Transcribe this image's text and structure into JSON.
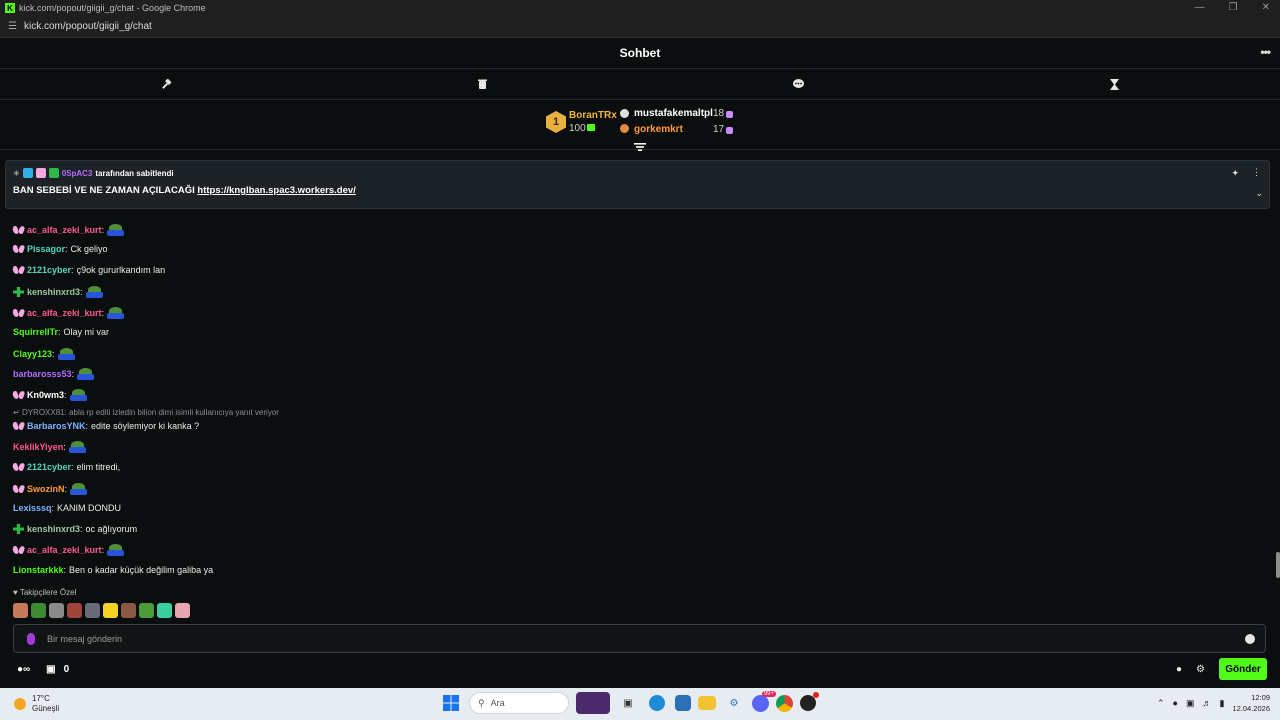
{
  "window": {
    "title": "kick.com/popout/giigii_g/chat - Google Chrome",
    "url": "kick.com/popout/giigii_g/chat"
  },
  "header": {
    "title": "Sohbet"
  },
  "leaderboard": {
    "first": {
      "name": "BoranTRx",
      "value": "100",
      "rank": "1"
    },
    "second": {
      "name": "mustafakemaltpl",
      "value": "18"
    },
    "third": {
      "name": "gorkemkrt",
      "value": "17"
    }
  },
  "pinned": {
    "user": "0SpAC3",
    "suffix": "tarafından sabitlendi",
    "message": "BAN SEBEBİ VE NE ZAMAN AÇILACAĞI",
    "link": "https://knglban.spac3.workers.dev/"
  },
  "messages": [
    {
      "badge": "butterfly",
      "user": "ac_alfa_zeki_kurt",
      "color": "#ff5a8a",
      "text": "",
      "emote": true
    },
    {
      "badge": "butterfly",
      "user": "Pissagor",
      "color": "#53d8c0",
      "text": "Ck geliyo",
      "emote": false
    },
    {
      "badge": "butterfly",
      "user": "2121cyber",
      "color": "#53d8c0",
      "text": "ç9ok gururlkandım lan",
      "emote": false
    },
    {
      "badge": "green",
      "user": "kenshinxrd3",
      "color": "#9bc8a0",
      "text": "",
      "emote": true
    },
    {
      "badge": "butterfly",
      "user": "ac_alfa_zeki_kurt",
      "color": "#ff5a8a",
      "text": "",
      "emote": true
    },
    {
      "badge": "",
      "user": "SquirrelITr",
      "color": "#53fc18",
      "text": "Olay mi var",
      "emote": false
    },
    {
      "badge": "",
      "user": "Clayy123",
      "color": "#53fc18",
      "text": "",
      "emote": true
    },
    {
      "badge": "",
      "user": "barbarosss53",
      "color": "#b56cff",
      "text": "",
      "emote": true
    },
    {
      "badge": "butterfly",
      "user": "Kn0wm3",
      "color": "#ffffff",
      "text": "",
      "emote": true
    },
    {
      "badge": "butterfly",
      "user": "BarbarosYNK",
      "color": "#7fb2ff",
      "text": "edite söylemiyor ki kanka ?",
      "emote": false
    },
    {
      "badge": "",
      "user": "KeklikYiyen",
      "color": "#ff5a8a",
      "text": "",
      "emote": true
    },
    {
      "badge": "butterfly",
      "user": "2121cyber",
      "color": "#53d8c0",
      "text": "elim titredi,",
      "emote": false
    },
    {
      "badge": "butterfly",
      "user": "SwozinN",
      "color": "#ff9a3c",
      "text": "",
      "emote": true
    },
    {
      "badge": "",
      "user": "Lexisssq",
      "color": "#7fb2ff",
      "text": "KANIM DONDU",
      "emote": false
    },
    {
      "badge": "green",
      "user": "kenshinxrd3",
      "color": "#9bc8a0",
      "text": "oc ağlıyorum",
      "emote": false
    },
    {
      "badge": "butterfly",
      "user": "ac_alfa_zeki_kurt",
      "color": "#ff5a8a",
      "text": "",
      "emote": true
    },
    {
      "badge": "",
      "user": "Lionstarkkk",
      "color": "#53fc18",
      "text": "Ben o kadar küçük değilim galiba ya",
      "emote": false
    }
  ],
  "reply": {
    "text": "DYROXX81: abla rp editi izledin bilion dimi isimli kullanıcıya yanıt veriyor"
  },
  "followers": {
    "label": "Takipçilere Özel"
  },
  "input": {
    "placeholder": "Bir mesaj gönderin"
  },
  "bottom": {
    "count": "0",
    "send_label": "Gönder"
  },
  "taskbar": {
    "weather_temp": "17°C",
    "weather_desc": "Güneşli",
    "search": "Ara",
    "time": "12:09",
    "date": "12.04.2026",
    "badge": "99+"
  }
}
